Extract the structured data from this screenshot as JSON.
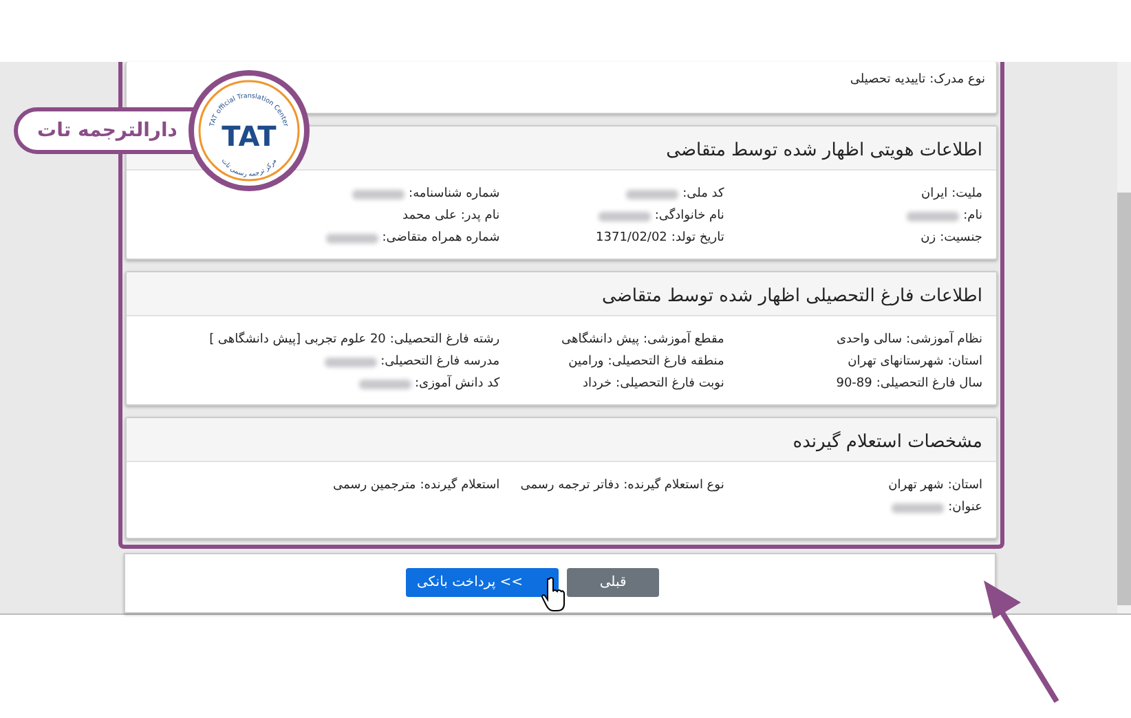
{
  "top_card": {
    "label": "نوع مدرک:",
    "value": "تاییدیه تحصیلی"
  },
  "badge": {
    "title": "دارالترجمه تات",
    "logo_text": "TAT",
    "ring_text": "TAT official Translation Center",
    "ring_text_bottom": "مرکز ترجمه رسمی تات"
  },
  "sections": [
    {
      "title": "اطلاعات هویتی اظهار شده توسط متقاضی",
      "fields": [
        {
          "label": "ملیت:",
          "value": "ایران",
          "kind": "text"
        },
        {
          "label": "کد ملی:",
          "kind": "redacted"
        },
        {
          "label": "شماره شناسنامه:",
          "kind": "redacted"
        },
        {
          "label": "نام:",
          "kind": "redacted"
        },
        {
          "label": "نام خانوادگی:",
          "kind": "redacted"
        },
        {
          "label": "نام پدر:",
          "value": "علی محمد",
          "kind": "text"
        },
        {
          "label": "جنسیت:",
          "value": "زن",
          "kind": "text"
        },
        {
          "label": "تاریخ تولد:",
          "value": "1371/02/02",
          "kind": "text"
        },
        {
          "label": "شماره همراه متقاضی:",
          "kind": "redacted"
        }
      ]
    },
    {
      "title": "اطلاعات فارغ التحصیلی اظهار شده توسط متقاضی",
      "fields": [
        {
          "label": "نظام آموزشی:",
          "value": "سالی واحدی",
          "kind": "text"
        },
        {
          "label": "مقطع آموزشی:",
          "value": "پیش دانشگاهی",
          "kind": "text"
        },
        {
          "label": "رشته فارغ التحصیلی:",
          "value": "20 علوم تجربی [پیش دانشگاهی ]",
          "kind": "text"
        },
        {
          "label": "استان:",
          "value": "شهرستانهای تهران",
          "kind": "text"
        },
        {
          "label": "منطقه فارغ التحصیلی:",
          "value": "ورامین",
          "kind": "text"
        },
        {
          "label": "مدرسه فارغ التحصیلی:",
          "kind": "redacted"
        },
        {
          "label": "سال فارغ التحصیلی:",
          "value": "90-89",
          "kind": "text"
        },
        {
          "label": "نوبت فارغ التحصیلی:",
          "value": "خرداد",
          "kind": "text"
        },
        {
          "label": "کد دانش آموزی:",
          "kind": "redacted"
        }
      ]
    },
    {
      "title": "مشخصات استعلام گیرنده",
      "fields": [
        {
          "label": "استان:",
          "value": "شهر تهران",
          "kind": "text"
        },
        {
          "label": "نوع استعلام گیرنده:",
          "value": "دفاتر ترجمه رسمی",
          "kind": "text"
        },
        {
          "label": "استعلام گیرنده:",
          "value": "مترجمین رسمی",
          "kind": "text"
        },
        {
          "label": "عنوان:",
          "kind": "redacted"
        }
      ]
    }
  ],
  "buttons": [
    {
      "label": "قبلی",
      "kind": "secondary"
    },
    {
      "label": ">> پرداخت بانکی",
      "kind": "primary"
    }
  ]
}
